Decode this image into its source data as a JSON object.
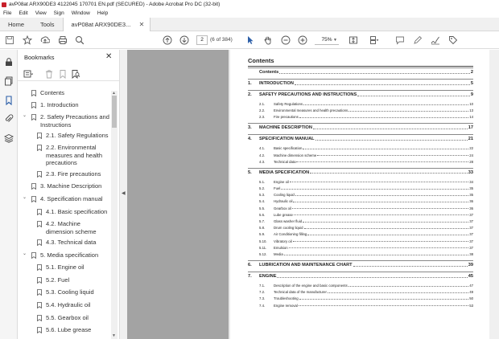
{
  "window": {
    "title": "avP08at ARX90DE3 4122045 170701 EN.pdf (SECURED) - Adobe Acrobat Pro DC (32-bit)"
  },
  "menu": [
    "File",
    "Edit",
    "View",
    "Sign",
    "Window",
    "Help"
  ],
  "tabs": [
    {
      "label": "Home"
    },
    {
      "label": "Tools"
    },
    {
      "label": "avP08at ARX90DE3..."
    }
  ],
  "toolbar": {
    "current_page": "2",
    "page_count": "(6 of 384)",
    "zoom": "75%"
  },
  "bookmarks": {
    "title": "Bookmarks",
    "items": [
      {
        "label": "Contents",
        "level": 0,
        "expandable": false
      },
      {
        "label": "1. Introduction",
        "level": 0,
        "expandable": false
      },
      {
        "label": "2. Safety Precautions and Instructions",
        "level": 0,
        "expandable": true
      },
      {
        "label": "2.1. Safety Regulations",
        "level": 1,
        "expandable": false
      },
      {
        "label": "2.2. Environmental measures and health precautions",
        "level": 1,
        "expandable": false
      },
      {
        "label": "2.3. Fire precautions",
        "level": 1,
        "expandable": false
      },
      {
        "label": "3. Machine Description",
        "level": 0,
        "expandable": false
      },
      {
        "label": "4. Specification manual",
        "level": 0,
        "expandable": true
      },
      {
        "label": "4.1. Basic specification",
        "level": 1,
        "expandable": false
      },
      {
        "label": "4.2. Machine dimension scheme",
        "level": 1,
        "expandable": false
      },
      {
        "label": "4.3. Technical data",
        "level": 1,
        "expandable": false
      },
      {
        "label": "5. Media specification",
        "level": 0,
        "expandable": true
      },
      {
        "label": "5.1. Engine oil",
        "level": 1,
        "expandable": false
      },
      {
        "label": "5.2. Fuel",
        "level": 1,
        "expandable": false
      },
      {
        "label": "5.3. Cooling liquid",
        "level": 1,
        "expandable": false
      },
      {
        "label": "5.4. Hydraulic oil",
        "level": 1,
        "expandable": false
      },
      {
        "label": "5.5. Gearbox oil",
        "level": 1,
        "expandable": false
      },
      {
        "label": "5.6. Lube grease",
        "level": 1,
        "expandable": false
      }
    ]
  },
  "document": {
    "heading": "Contents",
    "rows": [
      {
        "num": "",
        "label": "Contents",
        "page": "2",
        "main": true
      },
      {
        "num": "1.",
        "label": "INTRODUCTION",
        "page": "5",
        "main": true
      },
      {
        "num": "2.",
        "label": "SAFETY PRECAUTIONS AND INSTRUCTIONS",
        "page": "9",
        "main": true
      },
      {
        "num": "2.1.",
        "label": "Safety Regulations",
        "page": "10",
        "main": false
      },
      {
        "num": "2.2.",
        "label": "Environmental measures and health precautions",
        "page": "13",
        "main": false
      },
      {
        "num": "2.3.",
        "label": "Fire precautions",
        "page": "14",
        "main": false
      },
      {
        "num": "3.",
        "label": "MACHINE DESCRIPTION",
        "page": "17",
        "main": true
      },
      {
        "num": "4.",
        "label": "SPECIFICATION MANUAL",
        "page": "21",
        "main": true
      },
      {
        "num": "4.1.",
        "label": "Basic specification",
        "page": "22",
        "main": false
      },
      {
        "num": "4.2.",
        "label": "Machine dimension scheme",
        "page": "24",
        "main": false
      },
      {
        "num": "4.3.",
        "label": "Technical data",
        "page": "28",
        "main": false
      },
      {
        "num": "5.",
        "label": "MEDIA SPECIFICATION",
        "page": "33",
        "main": true
      },
      {
        "num": "5.1.",
        "label": "Engine oil",
        "page": "34",
        "main": false
      },
      {
        "num": "5.2.",
        "label": "Fuel",
        "page": "35",
        "main": false
      },
      {
        "num": "5.3.",
        "label": "Cooling liquid",
        "page": "35",
        "main": false
      },
      {
        "num": "5.4.",
        "label": "Hydraulic oil",
        "page": "36",
        "main": false
      },
      {
        "num": "5.5.",
        "label": "Gearbox oil",
        "page": "36",
        "main": false
      },
      {
        "num": "5.6.",
        "label": "Lube grease",
        "page": "37",
        "main": false
      },
      {
        "num": "5.7.",
        "label": "Glass washer fluid",
        "page": "37",
        "main": false
      },
      {
        "num": "5.8.",
        "label": "Drum cooling liquid",
        "page": "37",
        "main": false
      },
      {
        "num": "5.9.",
        "label": "Air Conditioning filling",
        "page": "37",
        "main": false
      },
      {
        "num": "5.10.",
        "label": "Vibratory oil",
        "page": "37",
        "main": false
      },
      {
        "num": "5.11.",
        "label": "Emulsion",
        "page": "37",
        "main": false
      },
      {
        "num": "5.12.",
        "label": "Media",
        "page": "38",
        "main": false
      },
      {
        "num": "6.",
        "label": "LUBRICATION AND MAINTENANCE CHART",
        "page": "39",
        "main": true
      },
      {
        "num": "7.",
        "label": "ENGINE",
        "page": "45",
        "main": true
      },
      {
        "num": "7.1.",
        "label": "Description of the engine and basic components",
        "page": "47",
        "main": false
      },
      {
        "num": "7.2.",
        "label": "Technical data of the manufacturer",
        "page": "49",
        "main": false
      },
      {
        "num": "7.3.",
        "label": "Troubleshooting",
        "page": "50",
        "main": false
      },
      {
        "num": "7.4.",
        "label": "Engine removal",
        "page": "53",
        "main": false
      }
    ]
  }
}
